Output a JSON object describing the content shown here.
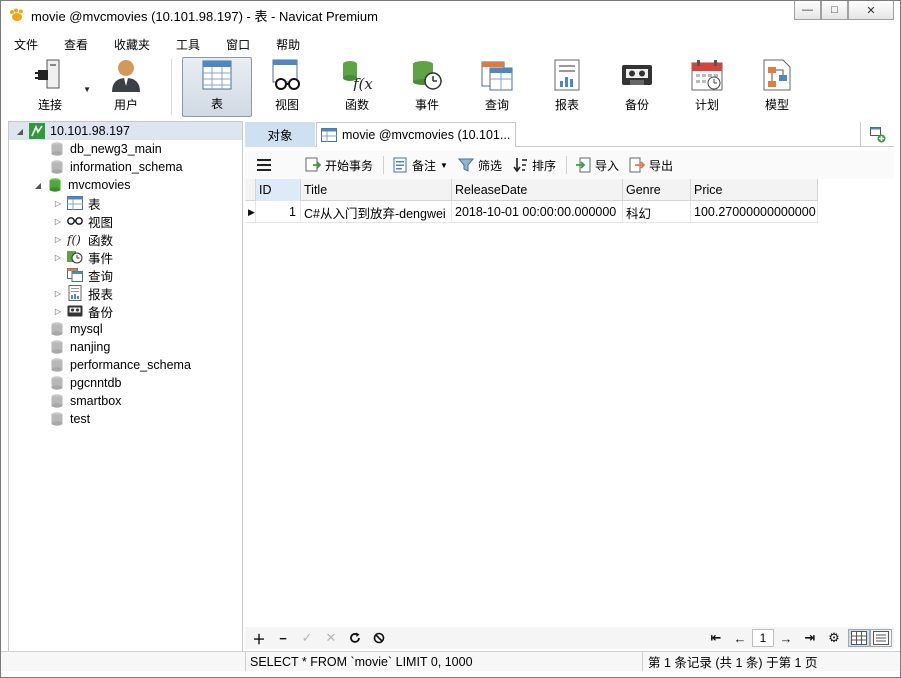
{
  "window": {
    "title": "movie @mvcmovies (10.101.98.197) - 表 - Navicat Premium",
    "controls": {
      "minimize": "—",
      "maximize": "□",
      "close": "✕"
    }
  },
  "menu": [
    "文件",
    "查看",
    "收藏夹",
    "工具",
    "窗口",
    "帮助"
  ],
  "toolbar": {
    "connect": "连接",
    "user": "用户",
    "table": "表",
    "view": "视图",
    "function": "函数",
    "event": "事件",
    "query": "查询",
    "report": "报表",
    "backup": "备份",
    "schedule": "计划",
    "model": "模型"
  },
  "tree": {
    "connection": "10.101.98.197",
    "databases_before": [
      "db_newg3_main",
      "information_schema"
    ],
    "open_db": "mvcmovies",
    "open_db_children": [
      "表",
      "视图",
      "函数",
      "事件",
      "查询",
      "报表",
      "备份"
    ],
    "databases_after": [
      "mysql",
      "nanjing",
      "performance_schema",
      "pgcnntdb",
      "smartbox",
      "test"
    ]
  },
  "tabs": {
    "objects": "对象",
    "active": "movie @mvcmovies (10.101..."
  },
  "subtoolbar": {
    "begin_transaction": "开始事务",
    "memo": "备注",
    "filter": "筛选",
    "sort": "排序",
    "import": "导入",
    "export": "导出"
  },
  "grid": {
    "columns": [
      "ID",
      "Title",
      "ReleaseDate",
      "Genre",
      "Price"
    ],
    "rows": [
      [
        "1",
        "C#从入门到放弃-dengwei",
        "2018-10-01 00:00:00.000000",
        "科幻",
        "100.27000000000000"
      ]
    ]
  },
  "pagination": {
    "page": "1"
  },
  "status": {
    "sql": "SELECT * FROM `movie` LIMIT 0, 1000",
    "records": "第 1 条记录 (共 1 条) 于第 1 页"
  }
}
